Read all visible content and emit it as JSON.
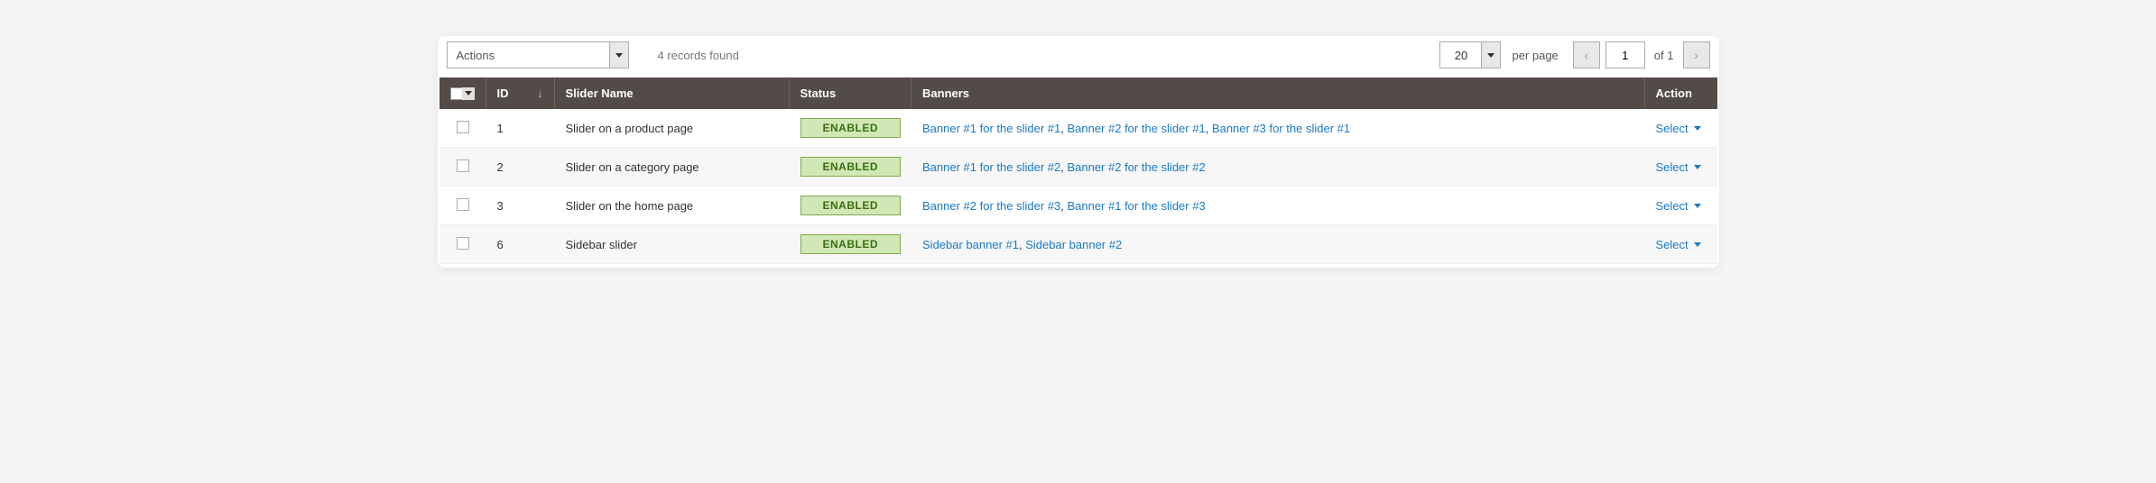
{
  "toolbar": {
    "actions_label": "Actions",
    "records_found": "4 records found"
  },
  "pagination": {
    "page_size": "20",
    "per_page_label": "per page",
    "current_page": "1",
    "of_label": "of",
    "total_pages": "1"
  },
  "columns": {
    "id": "ID",
    "slider_name": "Slider Name",
    "status": "Status",
    "banners": "Banners",
    "action": "Action"
  },
  "action_select_label": "Select",
  "rows": [
    {
      "id": "1",
      "name": "Slider on a product page",
      "status": "ENABLED",
      "banners": [
        "Banner #1 for the slider #1",
        "Banner #2 for the slider #1",
        "Banner #3 for the slider #1"
      ]
    },
    {
      "id": "2",
      "name": "Slider on a category page",
      "status": "ENABLED",
      "banners": [
        "Banner #1 for the slider #2",
        "Banner #2 for the slider #2"
      ]
    },
    {
      "id": "3",
      "name": "Slider on the home page",
      "status": "ENABLED",
      "banners": [
        "Banner #2 for the slider #3",
        "Banner #1 for the slider #3"
      ]
    },
    {
      "id": "6",
      "name": "Sidebar slider",
      "status": "ENABLED",
      "banners": [
        "Sidebar banner #1",
        "Sidebar banner #2"
      ]
    }
  ]
}
